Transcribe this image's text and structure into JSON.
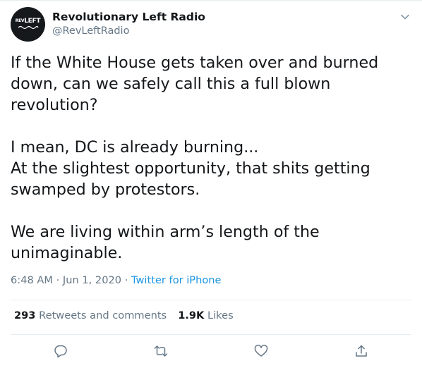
{
  "author": {
    "display_name": "Revolutionary Left Radio",
    "handle": "@RevLeftRadio",
    "avatar_logo_text": "REVLEFT"
  },
  "tweet": {
    "text": "If the White House gets taken over and burned\ndown, can we safely call this a full blown\nrevolution?\n\nI mean, DC is already burning...\nAt the slightest opportunity, that shits getting\nswamped by protestors.\n\nWe are living within arm’s length of the\nunimaginable.",
    "time": "6:48 AM",
    "separator": "·",
    "date": "Jun 1, 2020",
    "source": "Twitter for iPhone"
  },
  "stats": {
    "retweets_count": "293",
    "retweets_label": "Retweets and comments",
    "likes_count": "1.9K",
    "likes_label": "Likes"
  },
  "icons": {
    "menu": "chevron-down-icon",
    "reply": "comment-icon",
    "retweet": "retweet-icon",
    "like": "heart-icon",
    "share": "share-icon"
  },
  "colors": {
    "text": "#14171a",
    "secondary": "#657786",
    "link": "#1b95e0",
    "divider": "#e6ecf0"
  }
}
